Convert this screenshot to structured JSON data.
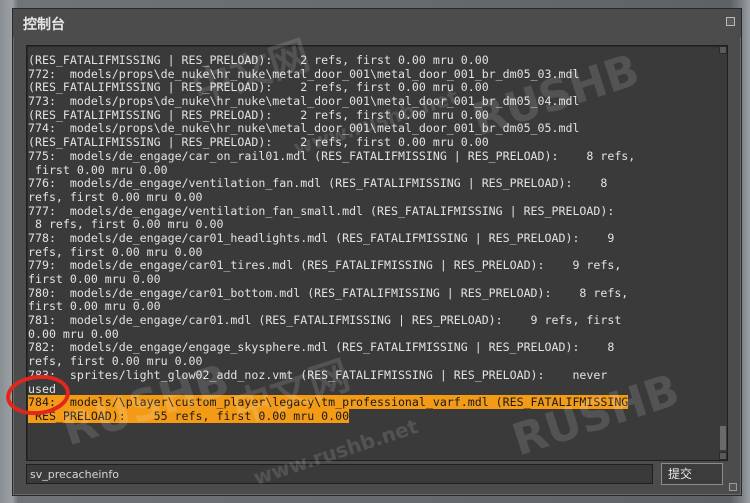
{
  "window": {
    "title": "控制台"
  },
  "console": {
    "lines": [
      "(RES_FATALIFMISSING | RES_PRELOAD):    2 refs, first 0.00 mru 0.00",
      "772:  models/props\\de_nuke\\hr_nuke\\metal_door_001\\metal_door_001_br_dm05_03.mdl",
      "(RES_FATALIFMISSING | RES_PRELOAD):    2 refs, first 0.00 mru 0.00",
      "773:  models/props\\de_nuke\\hr_nuke\\metal_door_001\\metal_door_001_br_dm05_04.mdl",
      "(RES_FATALIFMISSING | RES_PRELOAD):    2 refs, first 0.00 mru 0.00",
      "774:  models/props\\de_nuke\\hr_nuke\\metal_door_001\\metal_door_001_br_dm05_05.mdl",
      "(RES_FATALIFMISSING | RES_PRELOAD):    2 refs, first 0.00 mru 0.00",
      "775:  models/de_engage/car_on_rail01.mdl (RES_FATALIFMISSING | RES_PRELOAD):    8 refs,",
      " first 0.00 mru 0.00",
      "776:  models/de_engage/ventilation_fan.mdl (RES_FATALIFMISSING | RES_PRELOAD):    8",
      "refs, first 0.00 mru 0.00",
      "777:  models/de_engage/ventilation_fan_small.mdl (RES_FATALIFMISSING | RES_PRELOAD):",
      " 8 refs, first 0.00 mru 0.00",
      "778:  models/de_engage/car01_headlights.mdl (RES_FATALIFMISSING | RES_PRELOAD):    9",
      "refs, first 0.00 mru 0.00",
      "779:  models/de_engage/car01_tires.mdl (RES_FATALIFMISSING | RES_PRELOAD):    9 refs,",
      "first 0.00 mru 0.00",
      "780:  models/de_engage/car01_bottom.mdl (RES_FATALIFMISSING | RES_PRELOAD):    8 refs,",
      "first 0.00 mru 0.00",
      "781:  models/de_engage/car01.mdl (RES_FATALIFMISSING | RES_PRELOAD):    9 refs, first",
      "0.00 mru 0.00",
      "782:  models/de_engage/engage_skysphere.mdl (RES_FATALIFMISSING | RES_PRELOAD):    8",
      "refs, first 0.00 mru 0.00",
      "783:  sprites/light_glow02_add_noz.vmt (RES_FATALIFMISSING | RES_PRELOAD):    never",
      "used"
    ],
    "highlighted_lines": [
      "784:  models/\\player\\custom_player\\legacy\\tm_professional_varf.mdl (RES_FATALIFMISSING",
      " RES_PRELOAD):    55 refs, first 0.00 mru 0.00"
    ]
  },
  "command": {
    "value": "sv_precacheinfo"
  },
  "submit_button": {
    "label": "提交"
  },
  "watermark": {
    "brand": "RUSHB",
    "cn": "中文网",
    "url": "www.rushb.net"
  },
  "colors": {
    "highlight": "#f39b17",
    "annotation_circle": "#e0261d"
  }
}
